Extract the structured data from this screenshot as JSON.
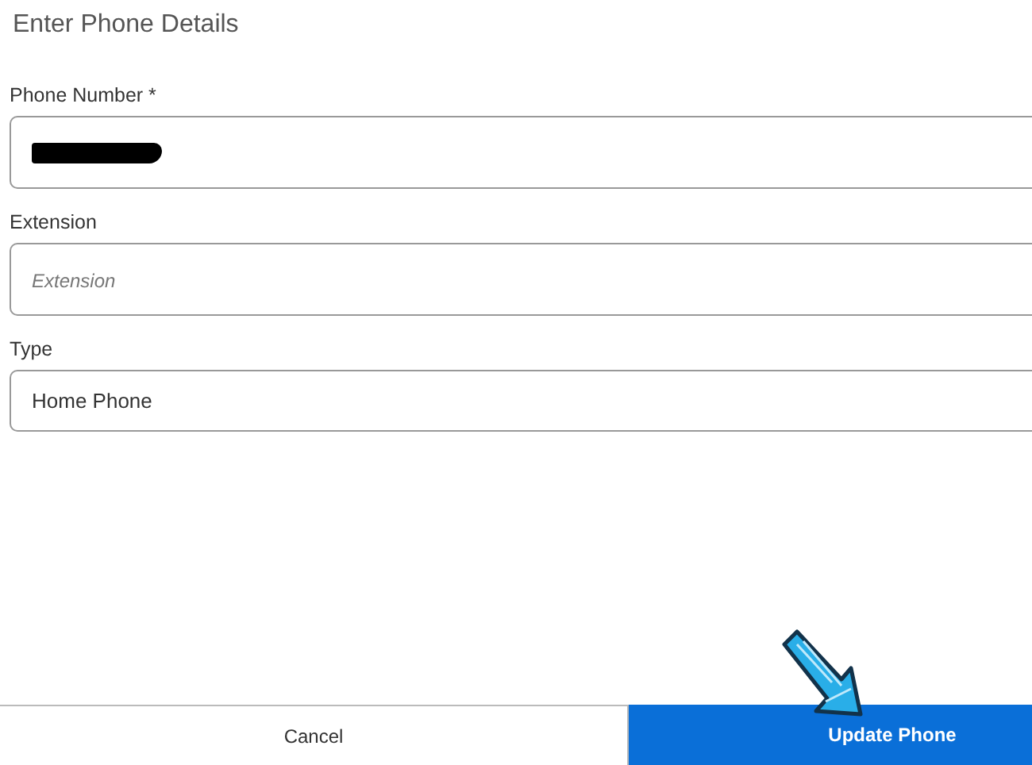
{
  "title": "Enter Phone Details",
  "fields": [
    {
      "label": "Phone Number *",
      "kind": "redacted"
    },
    {
      "label": "Extension",
      "kind": "input",
      "placeholder": "Extension"
    },
    {
      "label": "Type",
      "kind": "select",
      "value": "Home Phone"
    }
  ],
  "buttons": [
    {
      "label": "Cancel",
      "kind": "secondary"
    },
    {
      "label": "Update Phone",
      "kind": "primary"
    }
  ],
  "annotation": {
    "kind": "arrow"
  }
}
